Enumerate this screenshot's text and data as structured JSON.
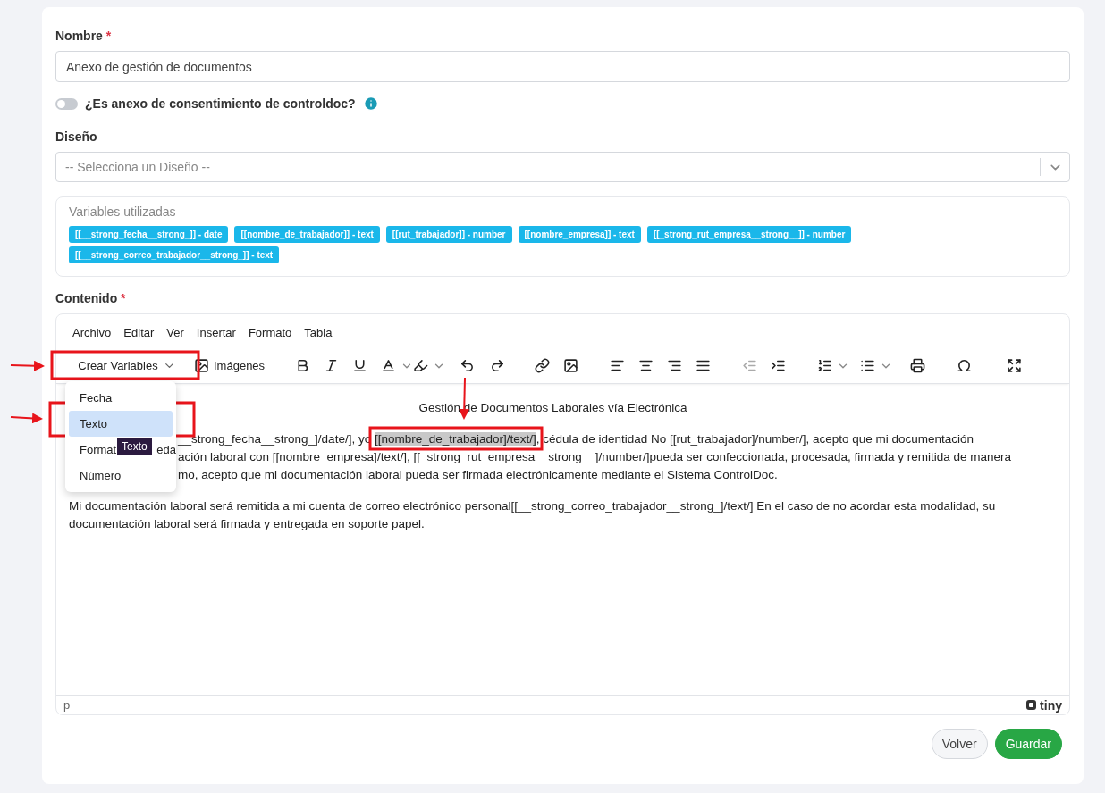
{
  "name_field": {
    "label": "Nombre",
    "required": true,
    "required_mark": "*",
    "value": "Anexo de gestión de documentos"
  },
  "consent_toggle": {
    "label": "¿Es anexo de consentimiento de controldoc?",
    "on": false
  },
  "design_field": {
    "label": "Diseño",
    "placeholder": "-- Selecciona un Diseño --"
  },
  "variables": {
    "title": "Variables utilizadas",
    "chips": [
      {
        "text": "[[__strong_fecha__strong_]] - date"
      },
      {
        "text": "[[nombre_de_trabajador]] - text"
      },
      {
        "text": "[[rut_trabajador]] - number"
      },
      {
        "text": "[[nombre_empresa]] - text"
      },
      {
        "text": "[[_strong_rut_empresa__strong__]] - number"
      },
      {
        "text": "[[__strong_correo_trabajador__strong_]] - text"
      }
    ]
  },
  "content": {
    "label": "Contenido",
    "required": true,
    "required_mark": "*"
  },
  "editor": {
    "menu": [
      "Archivo",
      "Editar",
      "Ver",
      "Insertar",
      "Formato",
      "Tabla"
    ],
    "create_variables": "Crear Variables",
    "images": "Imágenes",
    "dropdown": [
      {
        "label_parts": [
          "Fecha"
        ],
        "selected": false
      },
      {
        "label_parts": [
          "Texto"
        ],
        "selected": true
      },
      {
        "label_parts": [
          "Format",
          "eda"
        ],
        "selected": false
      },
      {
        "label_parts": [
          "Número"
        ],
        "selected": false
      }
    ],
    "tooltip": "Texto",
    "doc_title": "Gestión de Documentos Laborales vía Electrónica",
    "paragraph_1": [
      {
        "before": "__strong_fecha__strong_]/date/], yo ",
        "selection": "[[nombre_de_trabajador]/text/]",
        "after": ", cédula de identidad No [[rut_trabajador]/number/], acepto que mi documentación"
      },
      {
        "before": "ación laboral con [[nombre_empresa]/text/], [[_strong_rut_empresa__strong__]/number/]pueda ser confeccionada, procesada, firmada y remitida de manera"
      },
      {
        "before": "mo, acepto que mi documentación laboral pueda ser firmada electrónicamente mediante el Sistema ControlDoc."
      }
    ],
    "paragraph_2": "Mi documentación laboral será remitida a mi cuenta de correo electrónico personal[[__strong_correo_trabajador__strong_]/text/] En el caso de no acordar esta modalidad, su documentación laboral será firmada y entregada en soporte papel.",
    "path": "p",
    "brand": "tiny"
  },
  "buttons": [
    {
      "label": "Volver",
      "kind": "secondary"
    },
    {
      "label": "Guardar",
      "kind": "primary"
    }
  ]
}
